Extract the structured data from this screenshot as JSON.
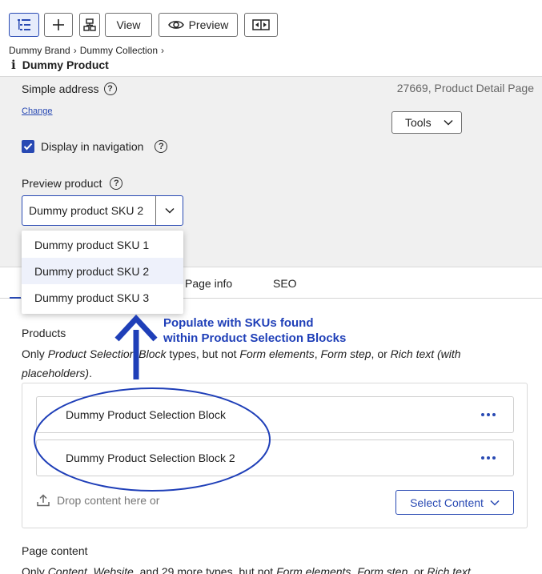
{
  "toolbar": {
    "view_label": "View",
    "preview_label": "Preview"
  },
  "breadcrumb": {
    "brand": "Dummy Brand",
    "collection": "Dummy Collection"
  },
  "page": {
    "info_glyph": "i",
    "title": "Dummy Product",
    "page_id_info": "27669, Product Detail Page"
  },
  "settings": {
    "simple_address_label": "Simple address",
    "change_link": "Change",
    "tools_label": "Tools",
    "display_in_nav_label": "Display in navigation",
    "display_in_nav_checked": true,
    "preview_product_label": "Preview product",
    "preview_product_value": "Dummy product SKU 2"
  },
  "dropdown": {
    "options": [
      "Dummy product SKU 1",
      "Dummy product SKU 2",
      "Dummy product SKU 3"
    ],
    "selected_index": 1
  },
  "tabs": {
    "page_info": "Page info",
    "seo": "SEO"
  },
  "products": {
    "label": "Products",
    "desc_1": "Only ",
    "desc_em_1": "Product Selection Block",
    "desc_2": " types, but not ",
    "desc_em_2": "Form elements",
    "desc_3": ", ",
    "desc_em_3": "Form step",
    "desc_4": ", or ",
    "desc_em_4": "Rich text (with placeholders)",
    "desc_5": ".",
    "blocks": [
      "Dummy Product Selection Block",
      "Dummy Product Selection Block 2"
    ],
    "drop_hint": "Drop content here or",
    "select_content_label": "Select Content"
  },
  "page_content": {
    "label": "Page content",
    "desc_1": "Only ",
    "desc_em_1": "Content",
    "desc_2": ", ",
    "desc_em_2": "Website",
    "desc_3": ", and 29 more types, but not ",
    "desc_em_3": "Form elements",
    "desc_4": ", ",
    "desc_em_4": "Form step",
    "desc_5": ", or ",
    "desc_em_5": "Rich text"
  },
  "annotation": {
    "line_1": "Populate with SKUs found",
    "line_2": "within Product Selection Blocks"
  },
  "colors": {
    "accent": "#2849b3",
    "annotation": "#1f3fb8",
    "panel_bg": "#f0f0f0"
  }
}
